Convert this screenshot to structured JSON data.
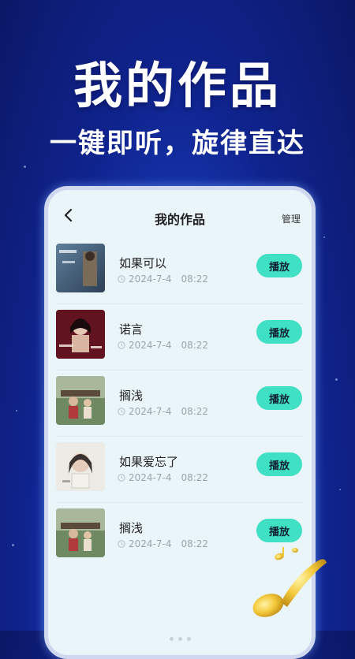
{
  "hero": {
    "title": "我的作品",
    "subtitle": "一键即听，旋律直达"
  },
  "appbar": {
    "title": "我的作品",
    "manage_label": "管理"
  },
  "works": [
    {
      "title": "如果可以",
      "date": "2024-7-4",
      "time": "08:22",
      "action": "播放",
      "cover": "cover-rugo"
    },
    {
      "title": "诺言",
      "date": "2024-7-4",
      "time": "08:22",
      "action": "播放",
      "cover": "cover-nuoyan"
    },
    {
      "title": "搁浅",
      "date": "2024-7-4",
      "time": "08:22",
      "action": "播放",
      "cover": "cover-family"
    },
    {
      "title": "如果爱忘了",
      "date": "2024-7-4",
      "time": "08:22",
      "action": "播放",
      "cover": "cover-woman"
    },
    {
      "title": "搁浅",
      "date": "2024-7-4",
      "time": "08:22",
      "action": "播放",
      "cover": "cover-family"
    }
  ],
  "colors": {
    "play_button": "#3fe0c4",
    "background_deep": "#0b1766",
    "background_light": "#3a7bf0"
  }
}
